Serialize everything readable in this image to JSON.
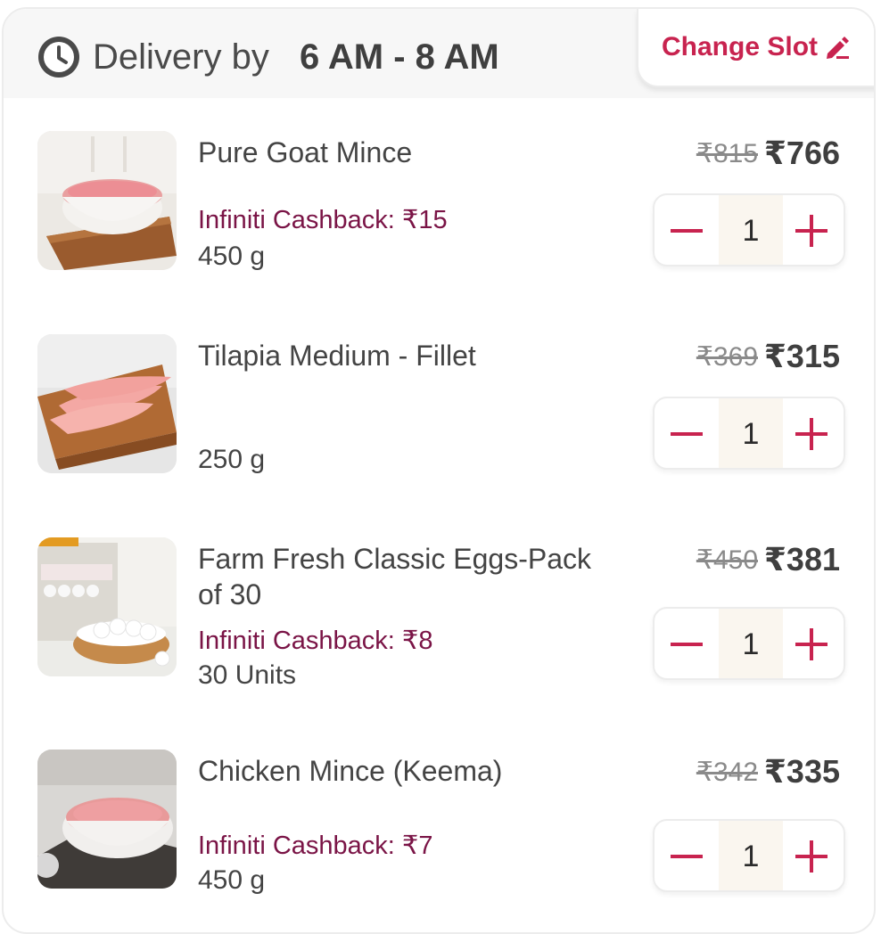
{
  "header": {
    "delivery_label": "Delivery by",
    "delivery_time": "6 AM - 8 AM",
    "change_slot_label": "Change Slot"
  },
  "colors": {
    "accent": "#c8234f",
    "cashback": "#7a1446",
    "header_bg": "#f7f7f7"
  },
  "items": [
    {
      "name": "Pure Goat Mince",
      "cashback": "Infiniti Cashback: ₹15",
      "weight": "450 g",
      "mrp": "₹815",
      "price": "₹766",
      "quantity": "1",
      "image_icon": "goat-mince-photo"
    },
    {
      "name": "Tilapia Medium - Fillet",
      "cashback": "",
      "weight": "250 g",
      "mrp": "₹369",
      "price": "₹315",
      "quantity": "1",
      "image_icon": "tilapia-fillet-photo"
    },
    {
      "name": "Farm Fresh Classic Eggs-Pack of 30",
      "cashback": "Infiniti Cashback: ₹8",
      "weight": "30 Units",
      "mrp": "₹450",
      "price": "₹381",
      "quantity": "1",
      "image_icon": "eggs-pack-photo"
    },
    {
      "name": "Chicken Mince (Keema)",
      "cashback": "Infiniti Cashback: ₹7",
      "weight": "450 g",
      "mrp": "₹342",
      "price": "₹335",
      "quantity": "1",
      "image_icon": "chicken-mince-photo"
    }
  ]
}
